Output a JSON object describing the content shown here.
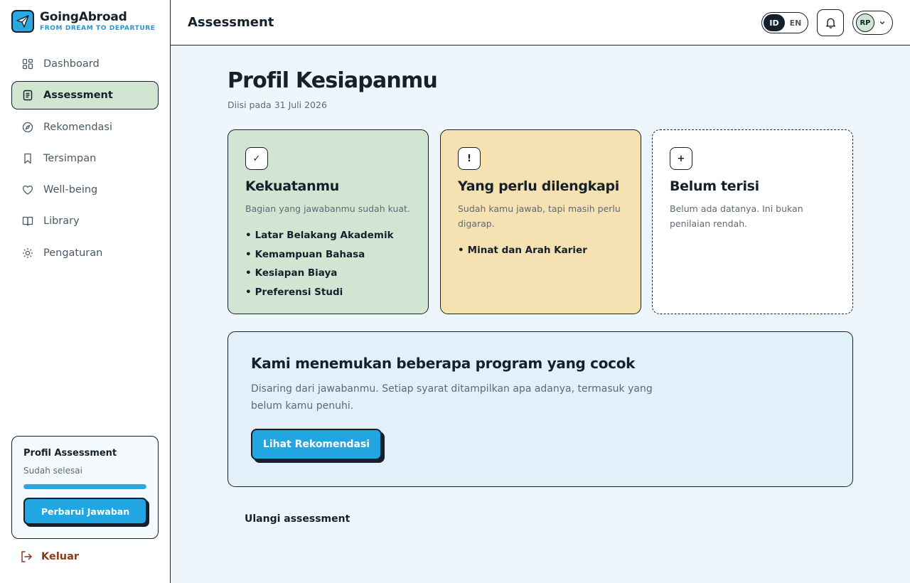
{
  "brand": {
    "name": "GoingAbroad",
    "tagline": "FROM DREAM TO DEPARTURE"
  },
  "sidebar": {
    "items": [
      {
        "label": "Dashboard",
        "icon": "dashboard-icon"
      },
      {
        "label": "Assessment",
        "icon": "document-icon",
        "active": true
      },
      {
        "label": "Rekomendasi",
        "icon": "compass-icon"
      },
      {
        "label": "Tersimpan",
        "icon": "bookmark-icon"
      },
      {
        "label": "Well-being",
        "icon": "heart-icon"
      },
      {
        "label": "Library",
        "icon": "book-icon"
      },
      {
        "label": "Pengaturan",
        "icon": "gear-icon"
      }
    ],
    "profile_card": {
      "title": "Profil Assessment",
      "status": "Sudah selesai",
      "progress": 1.0,
      "button": "Perbarui Jawaban"
    },
    "logout": "Keluar"
  },
  "header": {
    "title": "Assessment",
    "lang": [
      "ID",
      "EN"
    ],
    "active_lang": "ID",
    "user_initials": "RP"
  },
  "main": {
    "title": "Profil Kesiapanmu",
    "subtitle": "Diisi pada 31 Juli 2026",
    "cards": {
      "strengths": {
        "icon_glyph": "✓",
        "title": "Kekuatanmu",
        "desc": "Bagian yang jawabanmu sudah kuat.",
        "items": [
          "Latar Belakang Akademik",
          "Kemampuan Bahasa",
          "Kesiapan Biaya",
          "Preferensi Studi"
        ]
      },
      "needs": {
        "icon_glyph": "!",
        "title": "Yang perlu dilengkapi",
        "desc": "Sudah kamu jawab, tapi masih perlu digarap.",
        "items": [
          "Minat dan Arah Karier"
        ]
      },
      "empty": {
        "icon_glyph": "+",
        "title": "Belum terisi",
        "desc": "Belum ada datanya. Ini bukan penilaian rendah."
      }
    },
    "banner": {
      "title": "Kami menemukan beberapa program yang cocok",
      "desc": "Disaring dari jawabanmu. Setiap syarat ditampilkan apa adanya, termasuk yang belum kamu penuhi.",
      "button": "Lihat Rekomendasi"
    },
    "retake": "Ulangi assessment"
  },
  "colors": {
    "accent": "#22a6e2",
    "ink": "#14202c",
    "green_card": "#d1e5d2",
    "yellow_card": "#f5e1b1",
    "logout": "#8a3a17"
  }
}
